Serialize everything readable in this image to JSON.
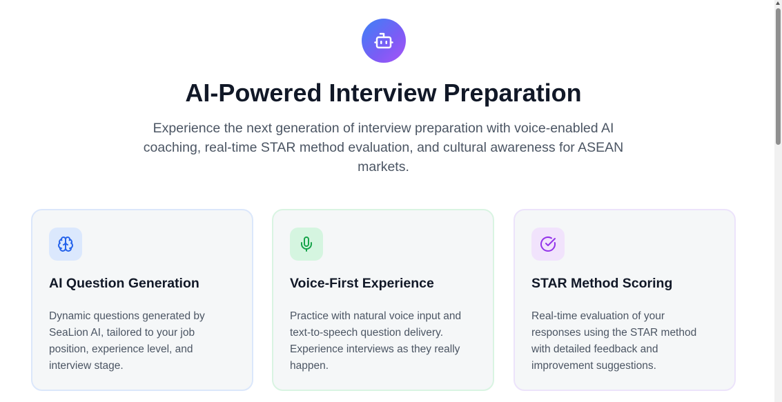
{
  "hero": {
    "icon": "bot-icon",
    "title": "AI-Powered Interview Preparation",
    "subtitle": "Experience the next generation of interview preparation with voice-enabled AI coaching, real-time STAR method evaluation, and cultural awareness for ASEAN markets."
  },
  "features": [
    {
      "icon": "brain-icon",
      "accent": "#2563eb",
      "title": "AI Question Generation",
      "description": "Dynamic questions generated by SeaLion AI, tailored to your job position, experience level, and interview stage."
    },
    {
      "icon": "microphone-icon",
      "accent": "#16a34a",
      "title": "Voice-First Experience",
      "description": "Practice with natural voice input and text-to-speech question delivery. Experience interviews as they really happen."
    },
    {
      "icon": "check-circle-icon",
      "accent": "#9333ea",
      "title": "STAR Method Scoring",
      "description": "Real-time evaluation of your responses using the STAR method with detailed feedback and improvement suggestions."
    }
  ],
  "colors": {
    "hero_gradient_start": "#3b82f6",
    "hero_gradient_end": "#a855f7",
    "card_background": "#f5f7f8"
  }
}
